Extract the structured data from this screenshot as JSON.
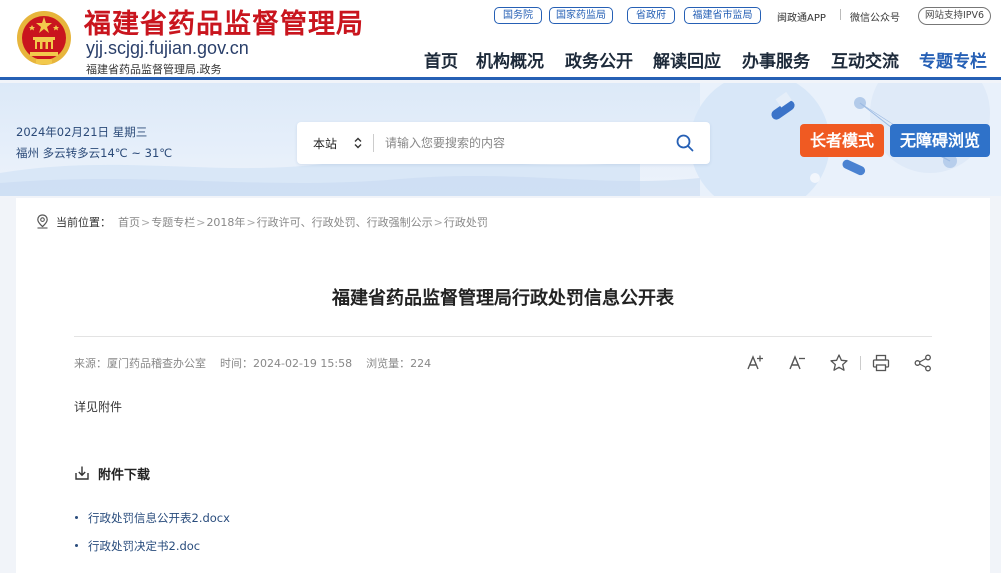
{
  "header": {
    "site_title": "福建省药品监督管理局",
    "site_domain": "yjj.scjgj.fujian.gov.cn",
    "site_subtitle": "福建省药品监督管理局.政务",
    "top_links": [
      "国务院",
      "国家药监局",
      "省政府",
      "福建省市监局"
    ],
    "util_links": [
      "闽政通APP",
      "微信公众号"
    ],
    "ipv6_label": "网站支持IPV6",
    "nav": [
      "首页",
      "机构概况",
      "政务公开",
      "解读回应",
      "办事服务",
      "互动交流",
      "专题专栏"
    ],
    "nav_active": "专题专栏"
  },
  "banner": {
    "date": "2024年02月21日  星期三",
    "weather": "福州  多云转多云14℃ ~ 31℃",
    "search_scope": "本站",
    "search_placeholder": "请输入您要搜索的内容",
    "elder_mode_label": "长者模式",
    "accessible_label": "无障碍浏览"
  },
  "breadcrumb": {
    "label": "当前位置：",
    "items": [
      "首页",
      "专题专栏",
      "2018年",
      "行政许可、行政处罚、行政强制公示",
      "行政处罚"
    ]
  },
  "article": {
    "title": "福建省药品监督管理局行政处罚信息公开表",
    "source": "来源：厦门药品稽查办公室",
    "time": "时间：2024-02-19 15:58",
    "views": "浏览量：224",
    "body": "详见附件",
    "attachments_title": "附件下载",
    "attachments": [
      "行政处罚信息公开表2.docx",
      "行政处罚决定书2.doc"
    ]
  },
  "colors": {
    "brand_red": "#c9151e",
    "brand_blue": "#2660b5",
    "elder_orange": "#f05a22",
    "access_blue": "#2f72c9"
  },
  "icons": [
    "national-emblem-icon",
    "chevron-updown-icon",
    "search-icon",
    "location-icon",
    "font-increase-icon",
    "font-decrease-icon",
    "favorite-star-icon",
    "print-icon",
    "share-icon",
    "download-icon"
  ]
}
